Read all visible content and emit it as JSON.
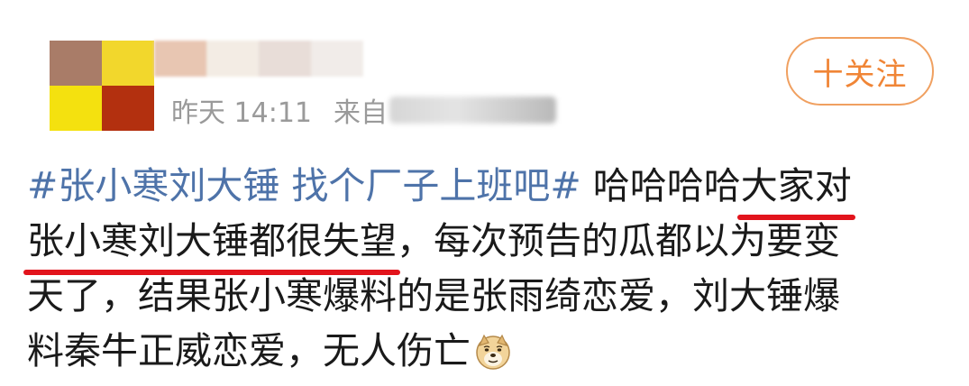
{
  "post": {
    "avatar_colors": [
      "#a97c68",
      "#f2d72c",
      "#f4e10f",
      "#b3300f"
    ],
    "username_blur_colors": [
      "#e8c6b2",
      "#f3ece4",
      "#e8ddd8",
      "#f1ece9"
    ],
    "time": "昨天 14:11",
    "source_label": "来自",
    "follow_label": "十关注",
    "accent_color": "#f08536",
    "hashtag_color": "#4e73a9",
    "underline_color": "#e2141c",
    "body": {
      "hashtag": "#张小寒刘大锤 找个厂子上班吧#",
      "line1_text": " 哈哈哈哈",
      "line1_highlight": "大家对",
      "line2_highlight": "张小寒刘大锤都很失望",
      "line2_text": "，每次预告的瓜都以为要变",
      "line3_text": "天了，结果张小寒爆料的是张雨绮恋爱，刘大锤爆",
      "line4_text": "料秦牛正威恋爱，无人伤亡",
      "emoji_name": "doge-emoji"
    }
  }
}
